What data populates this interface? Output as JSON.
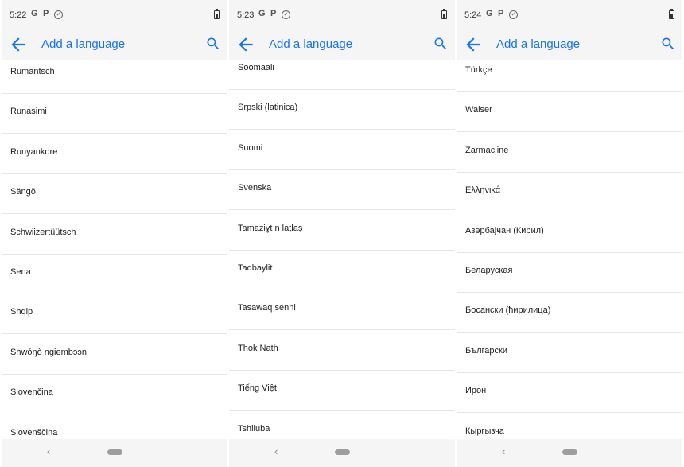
{
  "screens": [
    {
      "time": "5:22",
      "title": "Add a language",
      "languages": [
        "Rumantsch",
        "Runasimi",
        "Runyankore",
        "Sängö",
        "Schwiizertüütsch",
        "Sena",
        "Shqip",
        "Shwóŋò ngiembɔɔn",
        "Slovenčina",
        "Slovenščina"
      ]
    },
    {
      "time": "5:23",
      "title": "Add a language",
      "languages": [
        "Soomaali",
        "Srpski (latinica)",
        "Suomi",
        "Svenska",
        "Tamaziɣt n laṭlaṣ",
        "Taqbaylit",
        "Tasawaq senni",
        "Thok Nath",
        "Tiếng Việt",
        "Tshiluba"
      ]
    },
    {
      "time": "5:24",
      "title": "Add a language",
      "languages": [
        "Türkçe",
        "Walser",
        "Zarmaciine",
        "Ελληνικά",
        "Азәрбајҹан (Кирил)",
        "Беларуская",
        "Босански (ћирилица)",
        "Български",
        "Ирон",
        "Кыргызча"
      ]
    }
  ],
  "status_icons": [
    "google-g-icon",
    "p-icon",
    "check-circle-icon",
    "battery-icon"
  ],
  "nav": {
    "back_symbol": "‹"
  },
  "colors": {
    "accent": "#1a73e8",
    "text": "#202124",
    "bar_bg": "#f5f5f5"
  }
}
